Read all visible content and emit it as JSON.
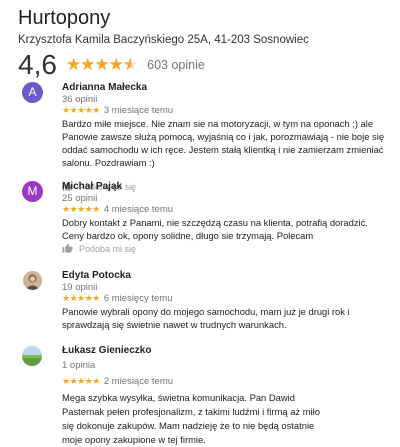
{
  "business": {
    "name": "Hurtopony",
    "address": "Krzysztofa Kamila Baczyńskiego 25A, 41-203 Sosnowiec",
    "rating": "4,6",
    "rating_value": 4.6,
    "review_count": "603 opinie"
  },
  "colors": {
    "star": "#f5a623",
    "avatar_a": "#6f58c9",
    "avatar_m": "#9c39c4"
  },
  "like_label": "Podoba mi się",
  "reviews": [
    {
      "name": "Adrianna Małecka",
      "count": "36 opinii",
      "avatar_letter": "A",
      "stars": "★★★★★",
      "time": "3 miesiące temu",
      "text": "Bardzo miłe miejsce. Nie znam sie na motoryzacji, w tym na oponach ;) ale Panowie zawsze służą pomocą, wyjaśnią co i jak, porozmawiają - nie boje się oddać samochodu w ich ręce. Jestem stałą klientką i nie zamierzam zmieniać salonu. Pozdrawiam :)"
    },
    {
      "name": "Michał Pająk",
      "count": "25 opinii",
      "avatar_letter": "M",
      "stars": "★★★★★",
      "time": "4 miesiące temu",
      "text": "Dobry kontakt z Panami, nie szczędzą czasu na klienta, potrafią doradzić. Ceny bardzo ok, opony solidne, długo sie trzymają. Polecam"
    },
    {
      "name": "Edyta Potocka",
      "count": "19 opinii",
      "stars": "★★★★★",
      "time": "6 miesięcy temu",
      "text": "Panowie wybrali opony do mojego samochodu, mam już je drugi rok i sprawdzają się świetnie nawet w trudnych warunkach."
    },
    {
      "name": "Łukasz Gieniec​zko",
      "count": "1 opinia",
      "stars": "★★★★★",
      "time": "2 miesiące temu",
      "text": "Mega szybka wysyłka, świetna komunikacja. Pan Dawid Pasternak pełen profesjonalizm, z takimi ludźmi i firmą aż miło się dokonuje zakupów. Mam nadzieję że to nie będą ostatnie moje opony zakupione w tej firmie."
    }
  ]
}
